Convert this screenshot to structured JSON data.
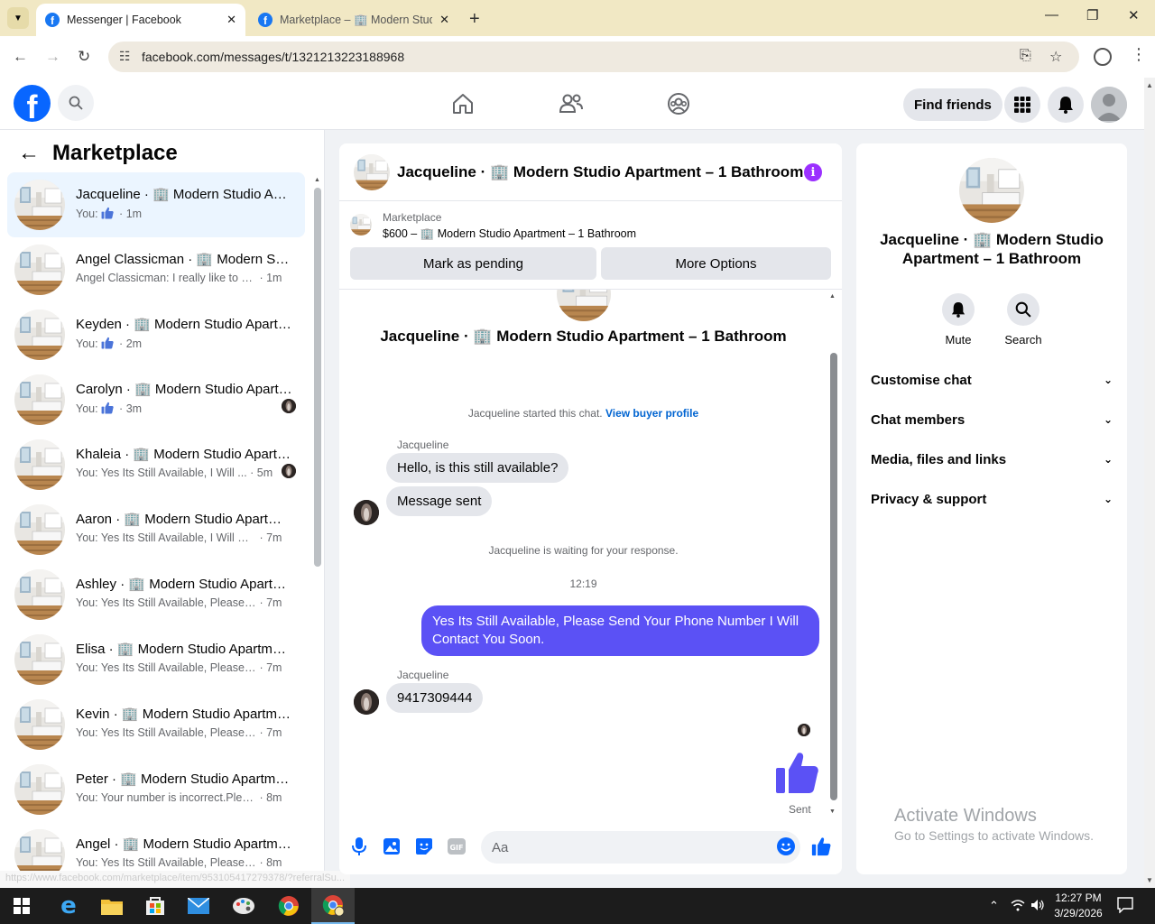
{
  "browser": {
    "tabs": [
      {
        "title": "Messenger | Facebook",
        "active": true
      },
      {
        "title": "Marketplace – 🏢 Modern Studio",
        "active": false
      }
    ],
    "url": "facebook.com/messages/t/1321213223188968",
    "status_url": "https://www.facebook.com/marketplace/item/953105417279378/?referralSu..."
  },
  "fbnav": {
    "find_friends": "Find friends"
  },
  "sidebar": {
    "title": "Marketplace",
    "conversations": [
      {
        "name": "Jacqueline · 🏢 Modern Studio Apartment – 1 Bathroom",
        "prefix": "You:",
        "text": "",
        "thumb": true,
        "time": "1m",
        "selected": true,
        "seen": false
      },
      {
        "name": "Angel Classicman · 🏢 Modern Studio Apartment – 1 Bathroom",
        "prefix": "",
        "text": "Angel Classicman: I really like to se...",
        "thumb": false,
        "time": "1m",
        "selected": false,
        "seen": false
      },
      {
        "name": "Keyden · 🏢 Modern Studio Apartment – 1 Bathroom",
        "prefix": "You:",
        "text": "",
        "thumb": true,
        "time": "2m",
        "selected": false,
        "seen": false
      },
      {
        "name": "Carolyn · 🏢 Modern Studio Apartment – 1 Bathroom",
        "prefix": "You:",
        "text": "",
        "thumb": true,
        "time": "3m",
        "selected": false,
        "seen": true
      },
      {
        "name": "Khaleia · 🏢 Modern Studio Apartment – 1 Bathroom",
        "prefix": "",
        "text": "You: Yes Its Still Available, I Will ...",
        "thumb": false,
        "time": "5m",
        "selected": false,
        "seen": true
      },
      {
        "name": "Aaron · 🏢 Modern Studio Apartment – 1 Bathroom",
        "prefix": "",
        "text": "You: Yes Its Still Available, I Will Co...",
        "thumb": false,
        "time": "7m",
        "selected": false,
        "seen": false
      },
      {
        "name": "Ashley · 🏢 Modern Studio Apartment – 1 Bathroom",
        "prefix": "",
        "text": "You: Yes Its Still Available, Please S...",
        "thumb": false,
        "time": "7m",
        "selected": false,
        "seen": false
      },
      {
        "name": "Elisa · 🏢 Modern Studio Apartment – 1 Bathroom",
        "prefix": "",
        "text": "You: Yes Its Still Available, Please S...",
        "thumb": false,
        "time": "7m",
        "selected": false,
        "seen": false
      },
      {
        "name": "Kevin · 🏢 Modern Studio Apartment – 1 Bathroom",
        "prefix": "",
        "text": "You: Yes Its Still Available, Please S...",
        "thumb": false,
        "time": "7m",
        "selected": false,
        "seen": false
      },
      {
        "name": "Peter · 🏢 Modern Studio Apartment – 1 Bathroom",
        "prefix": "",
        "text": "You: Your number is incorrect.Pleas...",
        "thumb": false,
        "time": "8m",
        "selected": false,
        "seen": false
      },
      {
        "name": "Angel · 🏢 Modern Studio Apartment – 1 Bathroom",
        "prefix": "",
        "text": "You: Yes Its Still Available, Please S...",
        "thumb": false,
        "time": "8m",
        "selected": false,
        "seen": false
      }
    ]
  },
  "chat": {
    "title": "Jacqueline · 🏢 Modern Studio Apartment – 1 Bathroom",
    "marketplace_label": "Marketplace",
    "listing": "$600 – 🏢 Modern Studio Apartment – 1 Bathroom",
    "mark_pending": "Mark as pending",
    "more_options": "More Options",
    "intro_title": "Jacqueline · 🏢 Modern Studio Apartment – 1 Bathroom",
    "started": "Jacqueline started this chat.",
    "view_profile": "View buyer profile",
    "sender1": "Jacqueline",
    "msg1": "Hello, is this still available?",
    "msg2": "Message sent",
    "waiting": "Jacqueline is waiting for your response.",
    "time": "12:19",
    "out_msg": "Yes Its Still Available, Please Send Your Phone Number I Will Contact You Soon.",
    "sender2": "Jacqueline",
    "msg3": "9417309444",
    "sent_label": "Sent",
    "placeholder": "Aa"
  },
  "rightpanel": {
    "title": "Jacqueline · 🏢 Modern Studio Apartment – 1 Bathroom",
    "mute": "Mute",
    "search": "Search",
    "sections": [
      "Customise chat",
      "Chat members",
      "Media, files and links",
      "Privacy & support"
    ]
  },
  "watermark": {
    "line1": "Activate Windows",
    "line2": "Go to Settings to activate Windows."
  },
  "taskbar": {
    "time": "12:27 PM",
    "date": "3/29/2026"
  },
  "colors": {
    "fb_blue": "#0866ff",
    "outgoing_bubble": "#5b51f5",
    "like": "#5b51f5"
  }
}
